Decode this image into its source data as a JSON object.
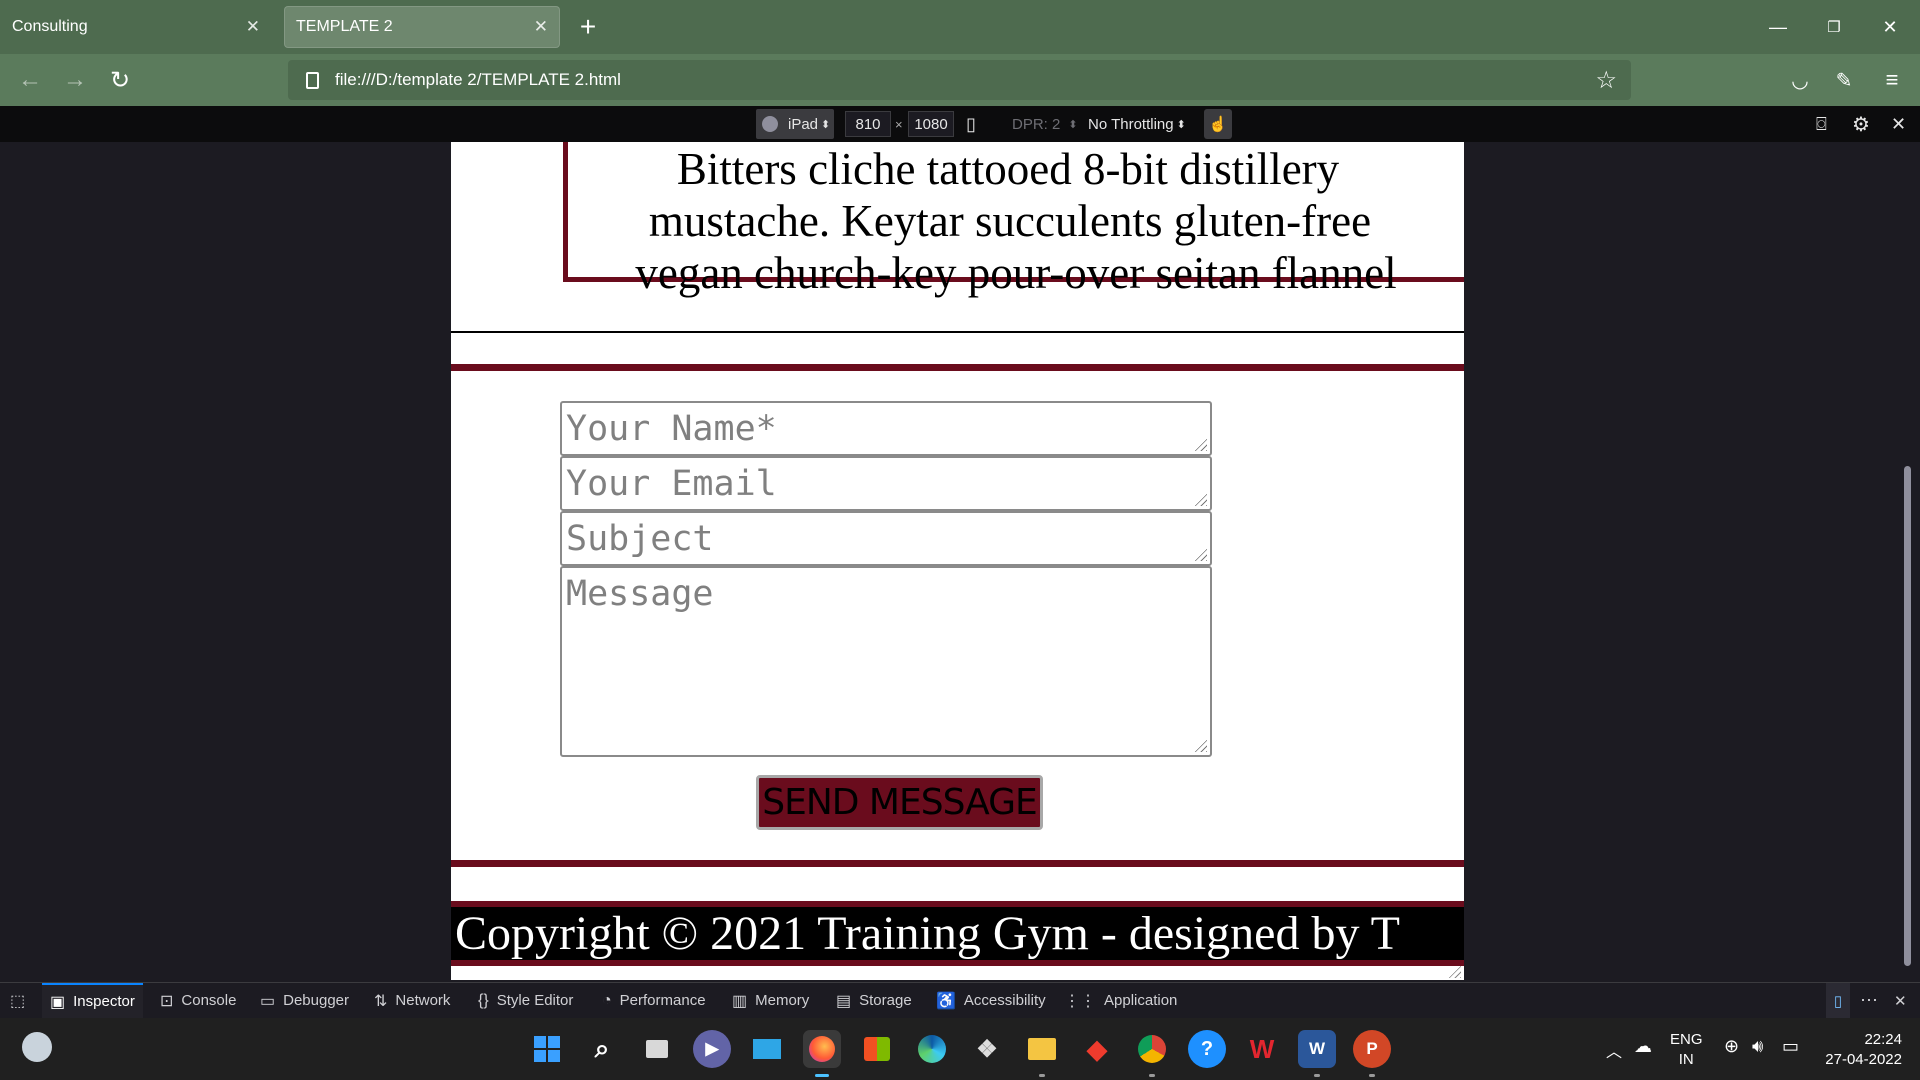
{
  "browser": {
    "tabs": [
      {
        "title": "Consulting",
        "active": false
      },
      {
        "title": "TEMPLATE 2",
        "active": true
      }
    ],
    "new_tab_label": "+",
    "url": "file:///D:/template 2/TEMPLATE 2.html",
    "colors": {
      "chrome": "#4e6b4f",
      "toolbar": "#5b7b5c"
    }
  },
  "rdm": {
    "device": "iPad",
    "width": "810",
    "times": "×",
    "height": "1080",
    "dpr": "DPR: 2",
    "throttling": "No Throttling"
  },
  "page": {
    "quote_lines": [
      "Bitters cliche tattooed 8-bit distillery",
      "mustache. Keytar succulents gluten-free",
      "vegan church-key pour-over seitan flannel"
    ],
    "form": {
      "name_placeholder": "Your Name*",
      "email_placeholder": "Your Email",
      "subject_placeholder": "Subject",
      "message_placeholder": "Message",
      "send_label": "SEND MESSAGE"
    },
    "footer_text": "Copyright © 2021 Training Gym - designed by T",
    "colors": {
      "accent": "#6a0c1d"
    }
  },
  "devtools": {
    "tabs": [
      "Inspector",
      "Console",
      "Debugger",
      "Network",
      "Style Editor",
      "Performance",
      "Memory",
      "Storage",
      "Accessibility",
      "Application"
    ],
    "icons": [
      "pick-element-icon",
      "inspector-icon",
      "console-icon",
      "debugger-icon",
      "network-icon",
      "style-editor-icon",
      "performance-icon",
      "memory-icon",
      "storage-icon",
      "accessibility-icon",
      "application-icon"
    ]
  },
  "taskbar": {
    "apps": [
      "start",
      "search",
      "task-view",
      "teams",
      "desktop",
      "firefox",
      "store",
      "edge",
      "dropbox",
      "file-explorer",
      "anydesk",
      "chrome",
      "help",
      "wps",
      "word",
      "powerpoint"
    ],
    "lang": "ENG",
    "region": "IN",
    "time": "22:24",
    "date": "27-04-2022"
  }
}
